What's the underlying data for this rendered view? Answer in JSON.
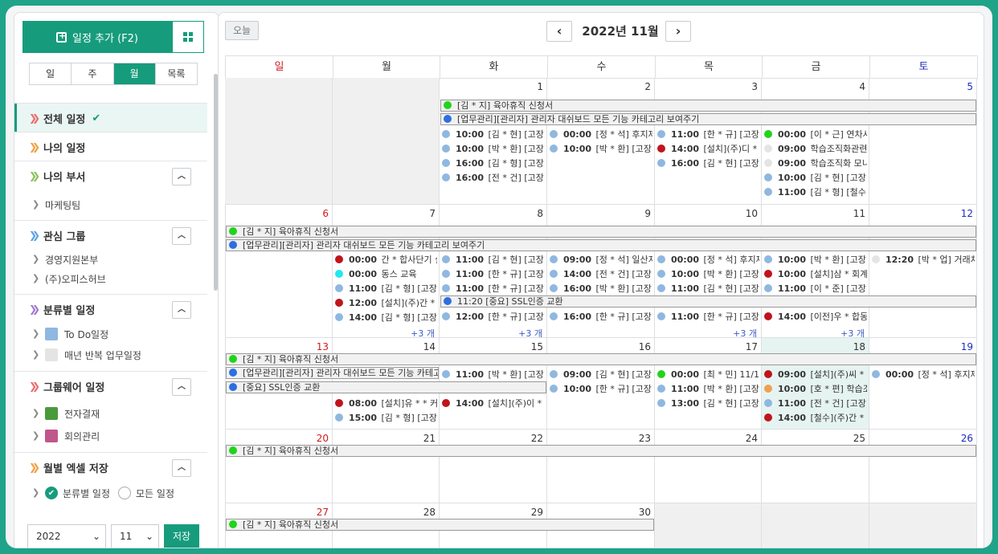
{
  "sidebar": {
    "add_button": "일정 추가 (F2)",
    "view_tabs": [
      "일",
      "주",
      "월",
      "목록"
    ],
    "active_tab": "월",
    "all_schedule": "전체 일정",
    "my_schedule": "나의 일정",
    "my_department": "나의 부서",
    "department_items": [
      "마케팅팀"
    ],
    "interest_group": "관심 그룹",
    "interest_items": [
      "경영지원본부",
      "(주)오피스허브"
    ],
    "category_schedule": "분류별 일정",
    "category_items": [
      "To Do일정",
      "매년 반복 업무일정"
    ],
    "groupware_schedule": "그룹웨어 일정",
    "groupware_items": [
      "전자결재",
      "회의관리"
    ],
    "excel_save": "월별 엑셀 저장",
    "radio_category": "분류별 일정",
    "radio_all": "모든 일정",
    "year_value": "2022",
    "month_value": "11",
    "save_button": "저장"
  },
  "header": {
    "today_button": "오늘",
    "month_title": "2022년 11월"
  },
  "calendar": {
    "weekdays": [
      "일",
      "월",
      "화",
      "수",
      "목",
      "금",
      "토"
    ],
    "weeks": [
      [
        "",
        "",
        "1",
        "2",
        "3",
        "4",
        "5"
      ],
      [
        "6",
        "7",
        "8",
        "9",
        "10",
        "11",
        "12"
      ],
      [
        "13",
        "14",
        "15",
        "16",
        "17",
        "18",
        "19"
      ],
      [
        "20",
        "21",
        "22",
        "23",
        "24",
        "25",
        "26"
      ],
      [
        "27",
        "28",
        "29",
        "30",
        "",
        "",
        ""
      ]
    ],
    "bars": {
      "leave": "[김 * 지] 육아휴직 신청서",
      "admin": "[업무관리][관리자] 관리자 대쉬보드 모든 기능 카테고리 보여주기",
      "ssl": "[중요] SSL인증 교환",
      "ssl_w2": "11:20 [중요] SSL인증 교환"
    },
    "events": {
      "w1_tue": [
        [
          "10:00",
          "[김 * 현] [고장](주"
        ],
        [
          "10:00",
          "[박 * 환] [고장]목"
        ],
        [
          "16:00",
          "[김 * 형] [고장](주"
        ],
        [
          "16:00",
          "[전 * 건] [고장]갈"
        ]
      ],
      "w1_wed": [
        [
          "00:00",
          "[정 * 석] 후지제스"
        ],
        [
          "10:00",
          "[박 * 환] [고장](주"
        ]
      ],
      "w1_thu": [
        [
          "11:00",
          "[한 * 규] [고장]동"
        ],
        [
          "14:00",
          "[설치](주)디 * 씨"
        ],
        [
          "16:00",
          "[김 * 현] [고장](주"
        ]
      ],
      "w1_fri": [
        [
          "00:00",
          "[이 * 근] 연차사유"
        ],
        [
          "09:00",
          "학습조직화관련"
        ],
        [
          "09:00",
          "학습조직화 모니"
        ],
        [
          "10:00",
          "[김 * 현] [고장](주"
        ],
        [
          "11:00",
          "[김 * 형] [철수]방"
        ]
      ],
      "w2_mon": [
        [
          "00:00",
          "간 *  합사단기 실"
        ],
        [
          "00:00",
          "동스 교육"
        ],
        [
          "11:00",
          "[김 * 형] [고장](주"
        ],
        [
          "12:00",
          "[설치](주)간 * 건"
        ],
        [
          "14:00",
          "[김 * 형] [고장](주"
        ]
      ],
      "w2_tue": [
        [
          "11:00",
          "[김 * 현] [고장](주"
        ],
        [
          "11:00",
          "[한 * 규] [고장]이"
        ],
        [
          "11:00",
          "[한 * 규] [고장]이"
        ],
        [
          "12:00",
          "[한 * 규] [고장]티"
        ]
      ],
      "w2_wed": [
        [
          "09:00",
          "[정 * 석] 일산지사"
        ],
        [
          "14:00",
          "[전 * 건] [고장](주"
        ],
        [
          "16:00",
          "[박 * 환] [고장](주"
        ],
        [
          "16:00",
          "[한 * 규] [고장](주"
        ]
      ],
      "w2_thu": [
        [
          "00:00",
          "[정 * 석] 후지제스"
        ],
        [
          "10:00",
          "[박 * 환] [고장]시"
        ],
        [
          "11:00",
          "[김 * 현] [고장](주"
        ],
        [
          "11:00",
          "[한 * 규] [고장](주"
        ]
      ],
      "w2_fri": [
        [
          "10:00",
          "[박 * 환] [고장]옥"
        ],
        [
          "10:00",
          "[설치]삼 * 회계법"
        ],
        [
          "11:00",
          "[이 * 준] [고장](주"
        ],
        [
          "14:00",
          "[이전]우 * 합동공"
        ]
      ],
      "w2_sat": [
        [
          "12:20",
          "[박 * 업] 거래처"
        ]
      ],
      "w3_tue": [
        [
          "11:00",
          "[박 * 환] [고장](주"
        ],
        [
          "14:00",
          "[설치](주)이 * 스"
        ]
      ],
      "w3_wed": [
        [
          "09:00",
          "[김 * 현] [고장](주"
        ],
        [
          "10:00",
          "[한 * 규] [고장]밥"
        ]
      ],
      "w3_thu": [
        [
          "00:00",
          "[최 * 민] 11/17(목"
        ],
        [
          "11:00",
          "[박 * 환] [고장](주"
        ],
        [
          "13:00",
          "[김 * 현] [고장](주"
        ]
      ],
      "w3_fri": [
        [
          "09:00",
          "[설치](주)씨 * 스"
        ],
        [
          "10:00",
          "[호 * 편] 학습조직"
        ],
        [
          "11:00",
          "[전 * 건] [고장](주"
        ],
        [
          "14:00",
          "[철수](주)간 * 건"
        ]
      ],
      "w3_sat": [
        [
          "00:00",
          "[정 * 석] 후지제스"
        ]
      ],
      "w3_mon": [
        [
          "08:00",
          "[설치]유 * * 커피"
        ],
        [
          "15:00",
          "[김 * 형] [고장](주"
        ]
      ]
    },
    "more_label": "+3 개",
    "colors": {
      "green": "#22d31c",
      "blue": "#2d6ee0",
      "lightblue": "#8fb8e0",
      "red": "#c0141c",
      "cyan": "#22e8f0",
      "lightgray": "#e4e4e4",
      "orange": "#f0a050"
    }
  }
}
